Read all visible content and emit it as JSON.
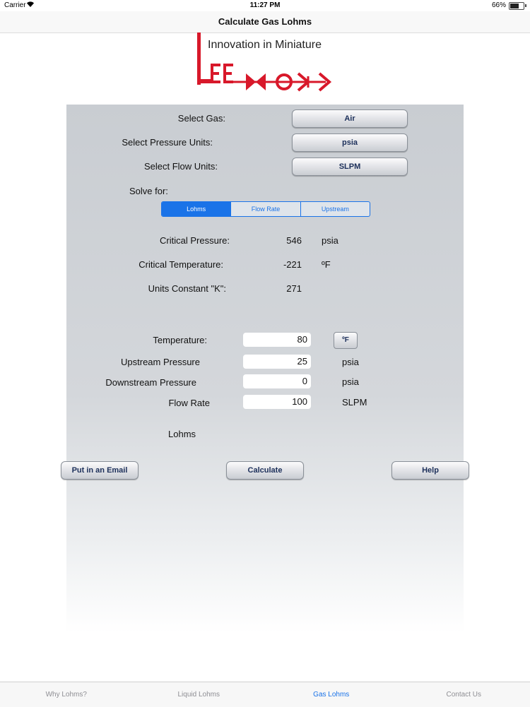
{
  "status": {
    "carrier": "Carrier",
    "time": "11:27 PM",
    "battery": "66%",
    "battery_level": 0.66
  },
  "nav": {
    "title": "Calculate Gas Lohms"
  },
  "logo": {
    "tagline": "Innovation in Miniature",
    "brand": "LEE"
  },
  "selectors": {
    "gas": {
      "label": "Select Gas:",
      "value": "Air"
    },
    "pressure_units": {
      "label": "Select Pressure Units:",
      "value": "psia"
    },
    "flow_units": {
      "label": "Select Flow Units:",
      "value": "SLPM"
    }
  },
  "solve_for": {
    "label": "Solve for:",
    "options": [
      "Lohms",
      "Flow Rate",
      "Upstream"
    ],
    "selected": "Lohms"
  },
  "constants": {
    "critical_pressure": {
      "label": "Critical Pressure:",
      "value": "546",
      "unit": "psia"
    },
    "critical_temperature": {
      "label": "Critical Temperature:",
      "value": "-221",
      "unit": "ºF"
    },
    "units_constant": {
      "label": "Units Constant \"K\":",
      "value": "271"
    }
  },
  "inputs": {
    "temperature": {
      "label": "Temperature:",
      "value": "80",
      "unit_button": "ºF"
    },
    "upstream": {
      "label": "Upstream Pressure",
      "value": "25",
      "unit": "psia"
    },
    "downstream": {
      "label": "Downstream Pressure",
      "value": "0",
      "unit": "psia"
    },
    "flow_rate": {
      "label": "Flow Rate",
      "value": "100",
      "unit": "SLPM"
    }
  },
  "result": {
    "label": "Lohms"
  },
  "actions": {
    "email": "Put in an Email",
    "calculate": "Calculate",
    "help": "Help"
  },
  "tabs": [
    "Why Lohms?",
    "Liquid Lohms",
    "Gas Lohms",
    "Contact Us"
  ],
  "active_tab": "Gas Lohms",
  "colors": {
    "accent": "#1a73e8",
    "logo_red": "#d8182a"
  }
}
